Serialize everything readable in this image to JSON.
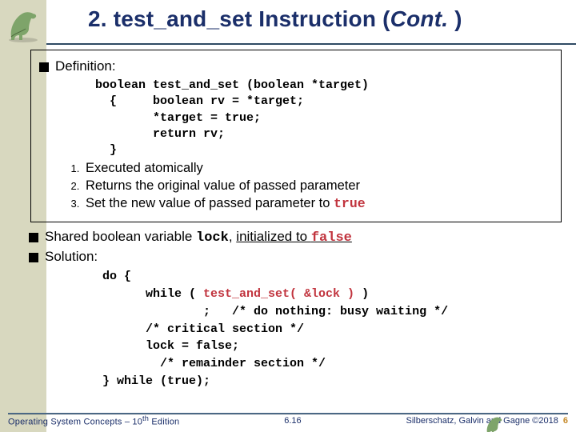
{
  "title_prefix": "2. test_and_set  Instruction (",
  "title_italic": "Cont.",
  "title_suffix": " )",
  "definition_label": "Definition:",
  "code_def": "boolean test_and_set (boolean *target)\n  {     boolean rv = *target;\n        *target = true;\n        return rv;\n  }",
  "ol": {
    "i1": "Executed atomically",
    "i2": "Returns the original value of passed parameter",
    "i3_pre": "Set the new value of passed parameter to ",
    "i3_kw": "true"
  },
  "shared_pre": "Shared boolean variable ",
  "shared_kw": "lock",
  "shared_mid": ", ",
  "shared_under_pre": "initialized to ",
  "shared_under_kw": "false",
  "solution_label": "Solution:",
  "sol_code": {
    "l1": "do {",
    "l2_pre": "      while ( ",
    "l2_red": "test_and_set( &lock )",
    "l2_post": " )",
    "l3": "              ;   /* do nothing: busy waiting */",
    "l4": "      /* critical section */",
    "l5": "      lock = false;",
    "l6": "        /* remainder section */",
    "l7": "} while (true);"
  },
  "footer": {
    "left_a": "Operating System Concepts – 10",
    "left_sup": "th",
    "left_b": " Edition",
    "mid": "6.16",
    "page_small": "6",
    "right_text": "Silberschatz, Galvin and Gagne ©2018"
  }
}
